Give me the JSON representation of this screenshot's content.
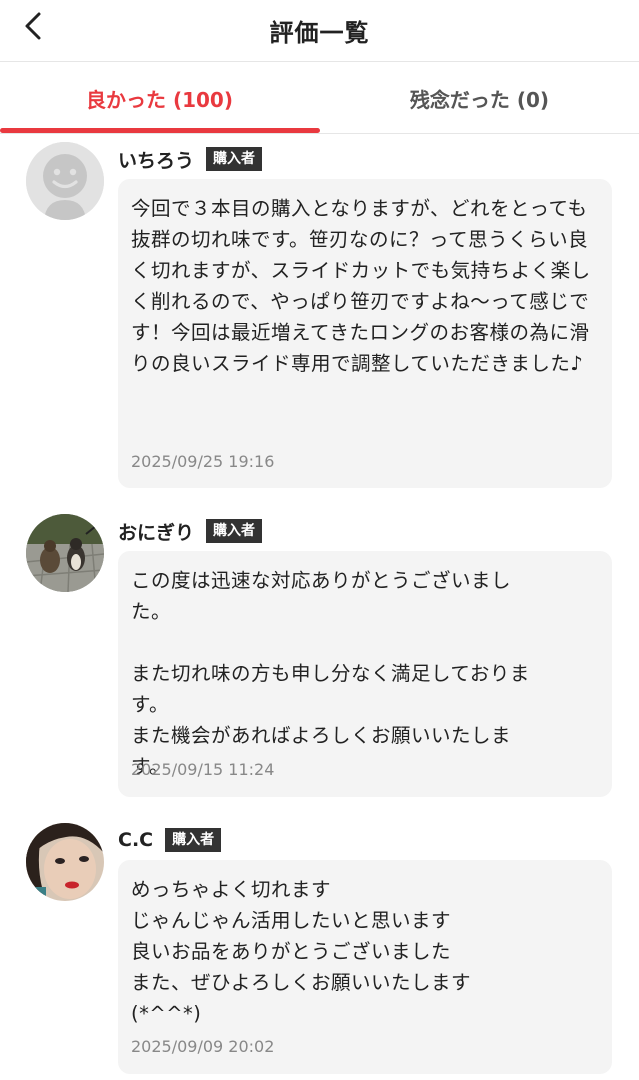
{
  "header": {
    "title": "評価一覧"
  },
  "tabs": [
    {
      "label": "良かった (100)"
    },
    {
      "label": "残念だった (0)"
    }
  ],
  "colors": {
    "accent": "#e9393f",
    "badge": "#333333",
    "bubble": "#f4f4f4"
  },
  "reviews": [
    {
      "name": "いちろう",
      "badge": "購入者",
      "comment": "今回で３本目の購入となりますが、どれをとっても抜群の切れ味です。笹刃なのに？って思うくらい良く切れますが、スライドカットでも気持ちよく楽しく削れるので、やっぱり笹刃ですよね〜って感じです！今回は最近増えてきたロングのお客様の為に滑りの良いスライド専用で調整していただきました♪",
      "date": "2025/09/25 19:16",
      "avatar": "default-avatar-icon"
    },
    {
      "name": "おにぎり",
      "badge": "購入者",
      "comment": "この度は迅速な対応ありがとうございました。\n\nまた切れ味の方も申し分なく満足しております。\nまた機会があればよろしくお願いいたします。",
      "date": "2025/09/15 11:24",
      "avatar": "cats-photo-avatar"
    },
    {
      "name": "C.C",
      "badge": "購入者",
      "comment": "めっちゃよく切れます\nじゃんじゃん活用したいと思います\n良いお品をありがとうございました\nまた、ぜひよろしくお願いいたします\n(*^^*)",
      "date": "2025/09/09 20:02",
      "avatar": "portrait-photo-avatar"
    }
  ]
}
